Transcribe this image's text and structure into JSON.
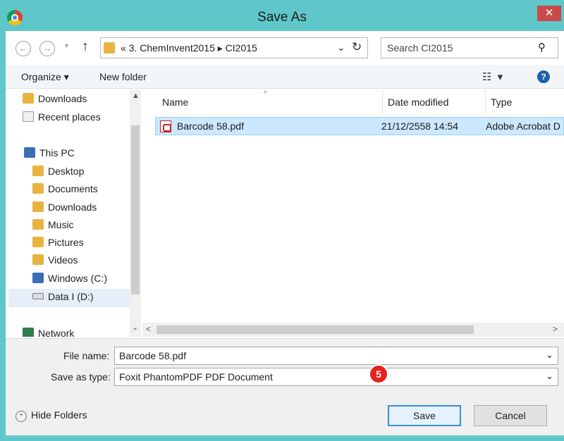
{
  "window": {
    "title": "Save As",
    "close_label": "✕"
  },
  "address": {
    "back_label": "←",
    "forward_label": "→",
    "dropdown_label": "▾",
    "up_label": "↑",
    "path": "« 3. ChemInvent2015 ▸ CI2015",
    "path_dropdown": "⌄",
    "refresh_label": "↻"
  },
  "search": {
    "placeholder": "Search CI2015",
    "icon_label": "⚲"
  },
  "toolbar": {
    "organize_label": "Organize ▾",
    "new_folder_label": "New folder",
    "views_label": "☷ ▾",
    "help_label": "?"
  },
  "nav": {
    "items": [
      {
        "label": "Downloads",
        "icon": "folder-download-icon"
      },
      {
        "label": "Recent places",
        "icon": "recent-places-icon"
      },
      {
        "label": "This PC",
        "icon": "this-pc-icon"
      },
      {
        "label": "Desktop",
        "icon": "desktop-folder-icon"
      },
      {
        "label": "Documents",
        "icon": "documents-folder-icon"
      },
      {
        "label": "Downloads",
        "icon": "downloads-folder-icon"
      },
      {
        "label": "Music",
        "icon": "music-folder-icon"
      },
      {
        "label": "Pictures",
        "icon": "pictures-folder-icon"
      },
      {
        "label": "Videos",
        "icon": "videos-folder-icon"
      },
      {
        "label": "Windows (C:)",
        "icon": "windows-drive-icon"
      },
      {
        "label": "Data I (D:)",
        "icon": "drive-icon"
      },
      {
        "label": "Network",
        "icon": "network-icon"
      }
    ],
    "scroll_up": "▲",
    "scroll_down": "⌄"
  },
  "files": {
    "columns": [
      "Name",
      "Date modified",
      "Type"
    ],
    "sort_arrow": "^",
    "rows": [
      {
        "name": "Barcode 58.pdf",
        "date": "21/12/2558 14:54",
        "type": "Adobe Acrobat D"
      }
    ],
    "scroll_left": "<",
    "scroll_right": ">"
  },
  "form": {
    "file_name_label": "File name:",
    "file_name_value": "Barcode 58.pdf",
    "save_as_type_label": "Save as type:",
    "save_as_type_value": "Foxit PhantomPDF PDF Document",
    "caret": "⌄"
  },
  "footer": {
    "hide_folders_label": "Hide Folders",
    "hide_folders_icon": "⌃",
    "save_label": "Save",
    "cancel_label": "Cancel",
    "step_marker": "5"
  },
  "colors": {
    "titlebar": "#5fc7c9",
    "selection": "#cce8ff",
    "step_marker": "#e3241b",
    "close": "#c94a4a"
  }
}
